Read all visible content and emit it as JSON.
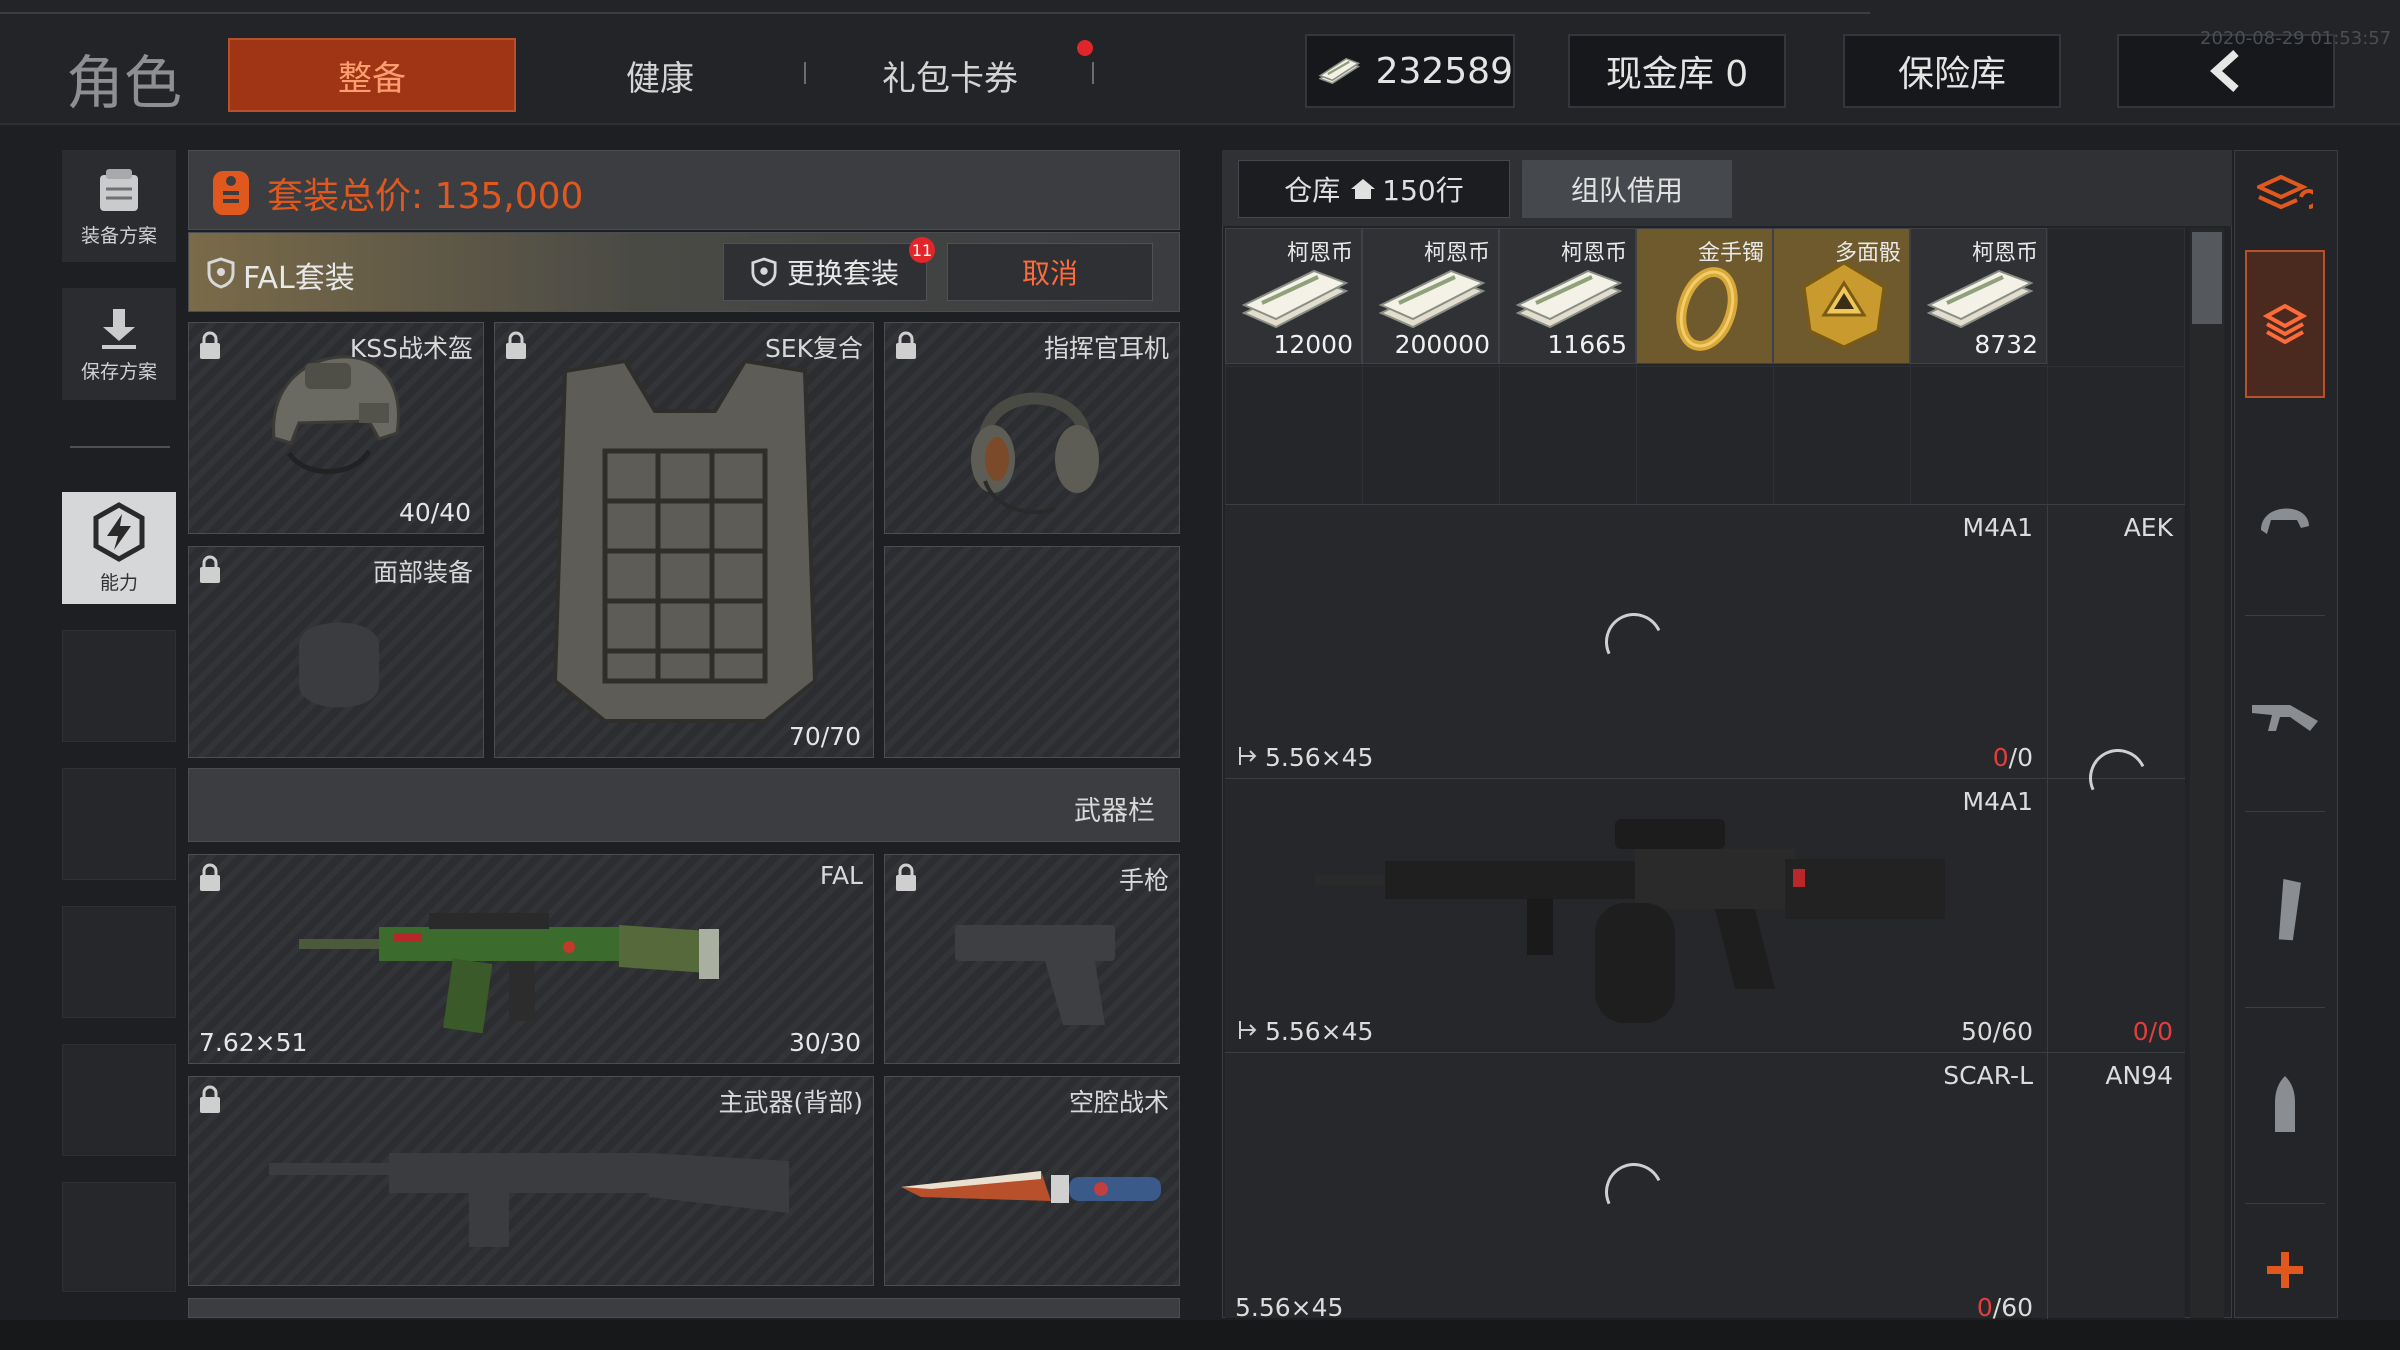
{
  "header": {
    "title": "角色",
    "tabs": [
      {
        "label": "整备",
        "active": true
      },
      {
        "label": "健康",
        "active": false
      },
      {
        "label": "礼包卡券",
        "active": false,
        "badge": true
      }
    ],
    "currency": "232589",
    "cash_vault": "现金库 0",
    "safe_box": "保险库",
    "timestamp": "2020-08-29 01:53:57"
  },
  "sidebar": {
    "items": [
      {
        "label": "装备方案",
        "icon": "backpack-icon"
      },
      {
        "label": "保存方案",
        "icon": "download-icon"
      },
      {
        "label": "能力",
        "icon": "ability-icon",
        "active": true
      }
    ]
  },
  "loadout": {
    "total_price_label": "套装总价: 135,000",
    "preset_name": "FAL套装",
    "change_button": "更换套装",
    "change_badge": "11",
    "cancel_button": "取消",
    "slots": {
      "helmet": {
        "label": "KSS战术盔",
        "value": "40/40"
      },
      "armor": {
        "label": "SEK复合",
        "value": "70/70"
      },
      "headset": {
        "label": "指挥官耳机"
      },
      "face": {
        "label": "面部装备"
      },
      "weapons_header": "武器栏",
      "primary": {
        "label": "FAL",
        "caliber": "7.62×51",
        "value": "30/30"
      },
      "pistol": {
        "label": "手枪"
      },
      "secondary": {
        "label": "主武器(背部)"
      },
      "melee": {
        "label": "空腔战术"
      }
    }
  },
  "warehouse": {
    "tabs": [
      {
        "label": "仓库",
        "suffix": "150行",
        "active": true
      },
      {
        "label": "组队借用",
        "active": false
      }
    ],
    "items": [
      {
        "name": "柯恩币",
        "count": "12000",
        "gold": false
      },
      {
        "name": "柯恩币",
        "count": "200000",
        "gold": false
      },
      {
        "name": "柯恩币",
        "count": "11665",
        "gold": false
      },
      {
        "name": "金手镯",
        "count": "",
        "gold": true
      },
      {
        "name": "多面骰",
        "count": "",
        "gold": true
      },
      {
        "name": "柯恩币",
        "count": "8732",
        "gold": false
      }
    ],
    "guns": [
      {
        "name": "M4A1",
        "caliber": "5.56×45",
        "ammo_red": "0",
        "ammo_total": "/0",
        "side_name": "AEK",
        "side_ammo": ""
      },
      {
        "name": "M4A1",
        "caliber": "5.56×45",
        "ammo": "50/60",
        "side_ammo_red": "0",
        "side_ammo_total": "/0"
      },
      {
        "name": "SCAR-L",
        "caliber": "5.56×45",
        "ammo_red": "0",
        "ammo_total": "/60",
        "side_name": "AN94"
      }
    ]
  },
  "categories": [
    "stack-swap-icon",
    "stack-icon",
    "helmet-icon",
    "rifle-icon",
    "magazine-icon",
    "bullet-icon",
    "plus-icon"
  ],
  "colors": {
    "accent": "#9f3514",
    "accent_text": "#ff9c70",
    "price_text": "#e0581e",
    "ammo_red": "#e33e3e",
    "gold_cell": "#6e5a2c"
  }
}
